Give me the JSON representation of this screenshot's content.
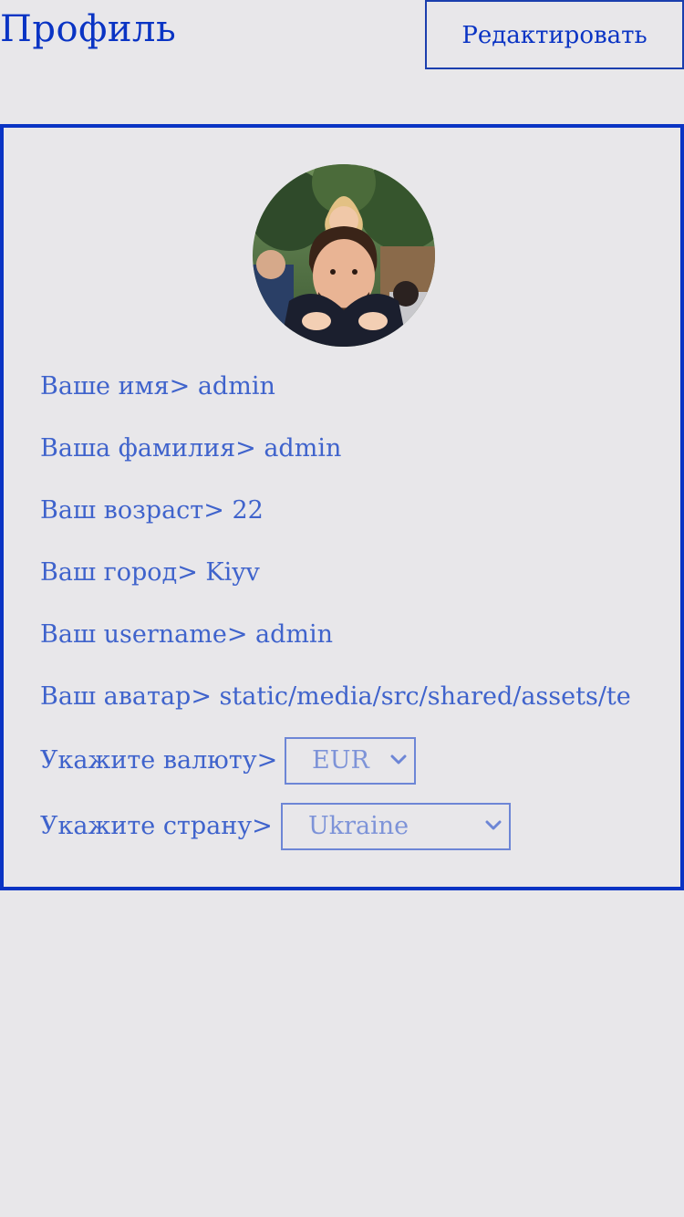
{
  "header": {
    "title": "Профиль",
    "edit_label": "Редактировать"
  },
  "profile": {
    "avatar_alt": "avatar photo",
    "first_name_row": "Ваше имя> admin",
    "last_name_row": "Ваша фамилия> admin",
    "age_row": "Ваш возраст> 22",
    "city_row": "Ваш город> Kiyv",
    "username_row": "Ваш username> admin",
    "avatar_row": "Ваш аватар> static/media/src/shared/assets/te"
  },
  "settings": {
    "currency_label": "Укажите валюту>",
    "currency_value": "EUR",
    "country_label": "Укажите страну>",
    "country_value": "Ukraine"
  },
  "colors": {
    "accent": "#0a34c4",
    "text": "#3f63cc",
    "background": "#e8e7ea"
  }
}
